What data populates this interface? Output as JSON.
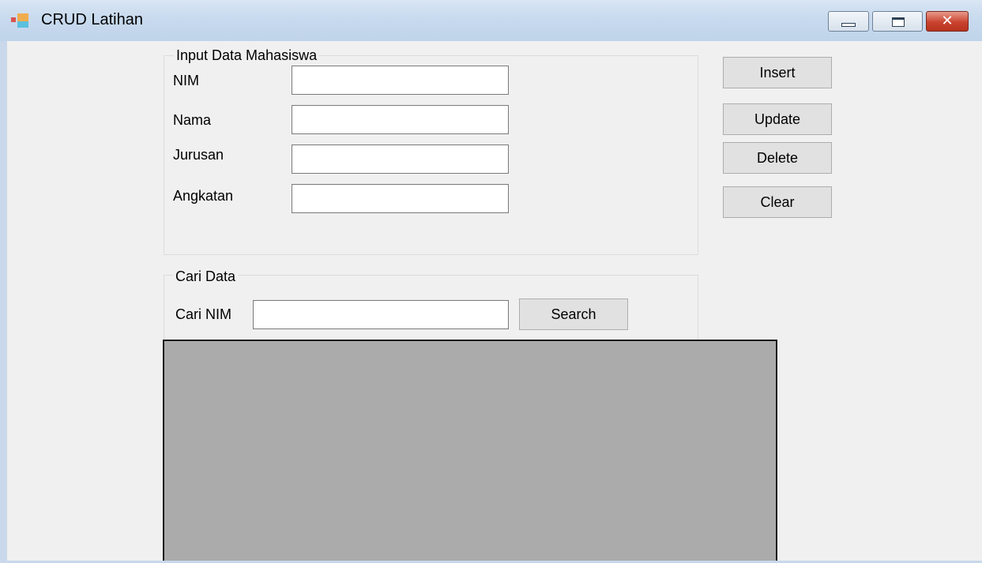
{
  "window": {
    "title": "CRUD Latihan",
    "icon": "app-window-icon",
    "close_glyph": "✕"
  },
  "input_group": {
    "title": "Input Data Mahasiswa",
    "fields": [
      {
        "label": "NIM",
        "value": ""
      },
      {
        "label": "Nama",
        "value": ""
      },
      {
        "label": "Jurusan",
        "value": ""
      },
      {
        "label": "Angkatan",
        "value": ""
      }
    ]
  },
  "actions": {
    "insert": "Insert",
    "update": "Update",
    "delete": "Delete",
    "clear": "Clear"
  },
  "search_group": {
    "title": "Cari Data",
    "label": "Cari NIM",
    "value": "",
    "button": "Search"
  },
  "colors": {
    "form_background": "#f0f0f0",
    "grid_background": "#ababab",
    "close_button": "#c9432f"
  }
}
